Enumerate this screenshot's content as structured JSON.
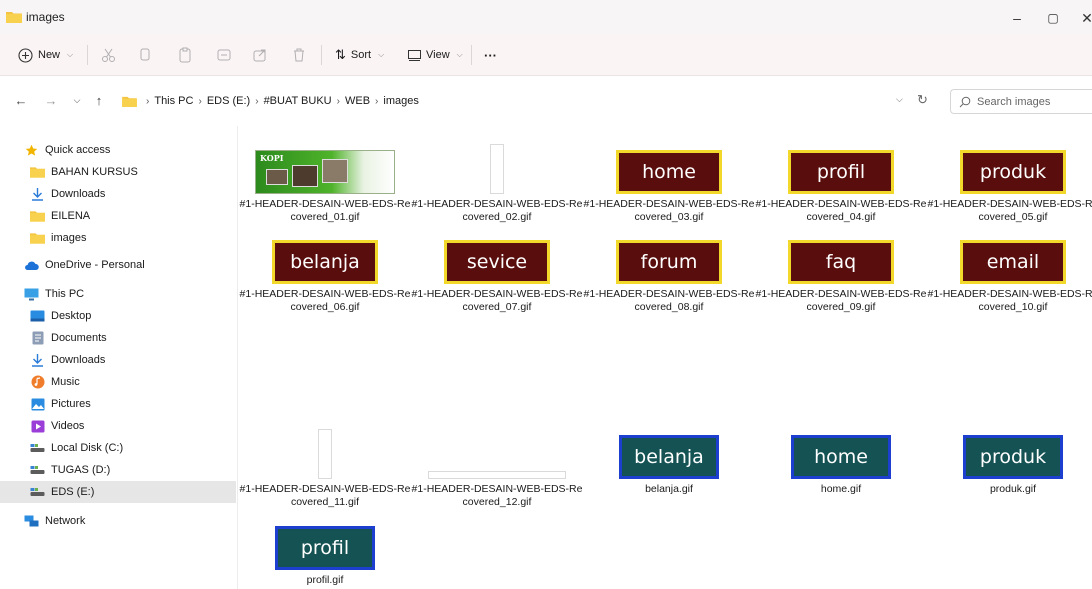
{
  "window": {
    "title": "images",
    "controls": [
      "–",
      "▢",
      "✕"
    ]
  },
  "commandbar": {
    "new_label": "New",
    "sort_label": "Sort",
    "view_label": "View",
    "more_label": "···"
  },
  "address": {
    "crumbs": [
      "This PC",
      "EDS (E:)",
      "#BUAT BUKU",
      "WEB",
      "images"
    ],
    "search_placeholder": "Search images"
  },
  "sidebar": {
    "items": [
      {
        "label": "Quick access",
        "icon": "star-icon"
      },
      {
        "label": "BAHAN KURSUS",
        "icon": "folder-icon"
      },
      {
        "label": "Downloads",
        "icon": "download-icon"
      },
      {
        "label": "EILENA",
        "icon": "folder-icon"
      },
      {
        "label": "images",
        "icon": "folder-icon"
      },
      {
        "label": "OneDrive - Personal",
        "icon": "cloud-icon"
      },
      {
        "label": "This PC",
        "icon": "monitor-icon"
      },
      {
        "label": "Desktop",
        "icon": "desktop-icon"
      },
      {
        "label": "Documents",
        "icon": "document-icon"
      },
      {
        "label": "Downloads",
        "icon": "download-icon"
      },
      {
        "label": "Music",
        "icon": "music-icon"
      },
      {
        "label": "Pictures",
        "icon": "pictures-icon"
      },
      {
        "label": "Videos",
        "icon": "video-icon"
      },
      {
        "label": "Local Disk (C:)",
        "icon": "drive-icon"
      },
      {
        "label": "TUGAS (D:)",
        "icon": "drive-icon"
      },
      {
        "label": "EDS (E:)",
        "icon": "drive-icon"
      },
      {
        "label": "Network",
        "icon": "network-icon"
      }
    ]
  },
  "files": [
    {
      "line1": "#1-HEADER-DESAIN-WEB-EDS-Re",
      "line2": "covered_01.gif",
      "thumb": "kopi-banner",
      "text": "KOPI"
    },
    {
      "line1": "#1-HEADER-DESAIN-WEB-EDS-Re",
      "line2": "covered_02.gif",
      "thumb": "blank-vertical",
      "text": ""
    },
    {
      "line1": "#1-HEADER-DESAIN-WEB-EDS-Re",
      "line2": "covered_03.gif",
      "thumb": "brown-button",
      "text": "home"
    },
    {
      "line1": "#1-HEADER-DESAIN-WEB-EDS-Re",
      "line2": "covered_04.gif",
      "thumb": "brown-button",
      "text": "profil"
    },
    {
      "line1": "#1-HEADER-DESAIN-WEB-EDS-Re",
      "line2": "covered_05.gif",
      "thumb": "brown-button",
      "text": "produk"
    },
    {
      "line1": "#1-HEADER-DESAIN-WEB-EDS-Re",
      "line2": "covered_06.gif",
      "thumb": "brown-button",
      "text": "belanja"
    },
    {
      "line1": "#1-HEADER-DESAIN-WEB-EDS-Re",
      "line2": "covered_07.gif",
      "thumb": "brown-button",
      "text": "sevice"
    },
    {
      "line1": "#1-HEADER-DESAIN-WEB-EDS-Re",
      "line2": "covered_08.gif",
      "thumb": "brown-button",
      "text": "forum"
    },
    {
      "line1": "#1-HEADER-DESAIN-WEB-EDS-Re",
      "line2": "covered_09.gif",
      "thumb": "brown-button",
      "text": "faq"
    },
    {
      "line1": "#1-HEADER-DESAIN-WEB-EDS-Re",
      "line2": "covered_10.gif",
      "thumb": "brown-button",
      "text": "email"
    },
    {
      "line1": "#1-HEADER-DESAIN-WEB-EDS-Re",
      "line2": "covered_11.gif",
      "thumb": "blank-vertical",
      "text": ""
    },
    {
      "line1": "#1-HEADER-DESAIN-WEB-EDS-Re",
      "line2": "covered_12.gif",
      "thumb": "blank-horizontal",
      "text": ""
    },
    {
      "line1": "belanja.gif",
      "line2": "",
      "thumb": "teal-button",
      "text": "belanja"
    },
    {
      "line1": "home.gif",
      "line2": "",
      "thumb": "teal-button",
      "text": "home"
    },
    {
      "line1": "produk.gif",
      "line2": "",
      "thumb": "teal-button",
      "text": "produk"
    },
    {
      "line1": "profil.gif",
      "line2": "",
      "thumb": "teal-button",
      "text": "profil"
    }
  ],
  "colors": {
    "folder": "#f4c542",
    "brown_button": "#5a0d0d",
    "brown_border": "#f2d82a",
    "teal_button": "#155254",
    "teal_border": "#1c3fcf",
    "selected_row": "#e6e6e6"
  }
}
